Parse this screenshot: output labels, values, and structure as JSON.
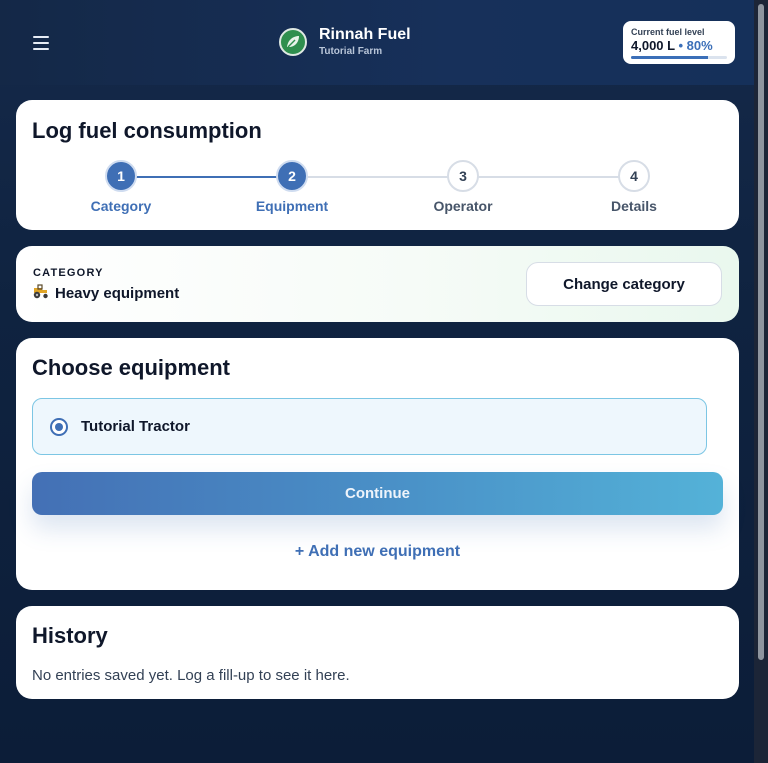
{
  "header": {
    "app_title": "Rinnah Fuel",
    "farm_name": "Tutorial Farm",
    "fuel": {
      "label": "Current fuel level",
      "amount": "4,000 L",
      "separator": "•",
      "percent_text": "80%",
      "fraction": 0.8
    },
    "menu_icon": "hamburger-menu-icon",
    "logo_icon": "leaf-logo-icon"
  },
  "wizard": {
    "title": "Log fuel consumption",
    "steps": [
      {
        "number": "1",
        "label": "Category",
        "state": "complete"
      },
      {
        "number": "2",
        "label": "Equipment",
        "state": "active"
      },
      {
        "number": "3",
        "label": "Operator",
        "state": "pending"
      },
      {
        "number": "4",
        "label": "Details",
        "state": "pending"
      }
    ]
  },
  "category": {
    "label": "CATEGORY",
    "icon": "tractor-icon",
    "value": "Heavy equipment",
    "change_label": "Change category"
  },
  "equipment": {
    "title": "Choose equipment",
    "options": [
      {
        "name": "Tutorial Tractor",
        "selected": true
      }
    ],
    "continue_label": "Continue",
    "add_label": "+ Add new equipment"
  },
  "history": {
    "title": "History",
    "empty_text": "No entries saved yet. Log a fill-up to see it here."
  },
  "colors": {
    "primary": "#3f6fb5",
    "header_bg": "#142847",
    "page_bg": "#0f2340",
    "option_border": "#7cc6e4",
    "continue_gradient_end": "#54b2d8"
  }
}
